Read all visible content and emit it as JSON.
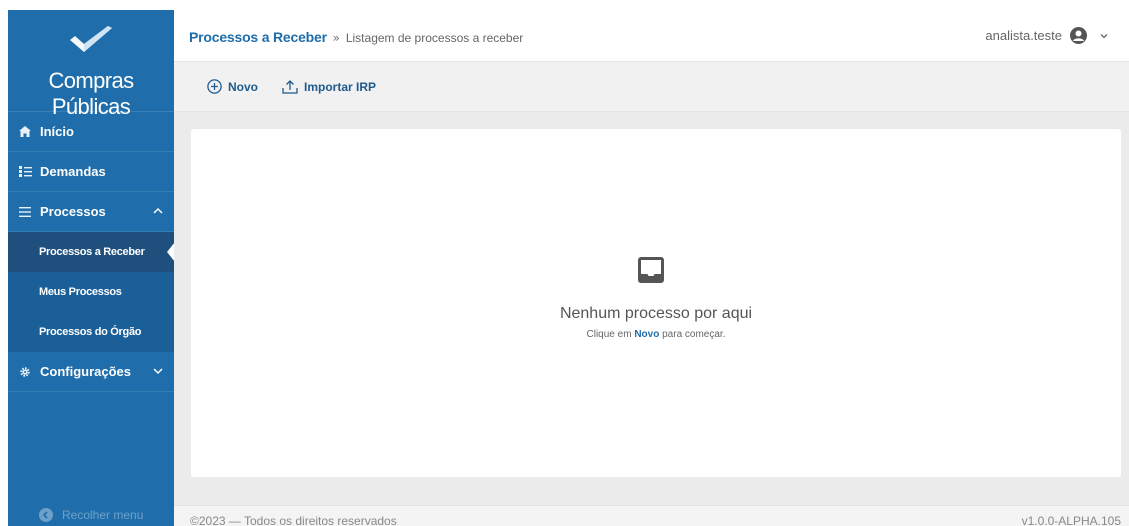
{
  "brand": {
    "name": "Compras Públicas",
    "logo_icon": "checkmark-logo-icon",
    "color": "#1f6eab"
  },
  "sidebar": {
    "items": [
      {
        "label": "Início",
        "icon": "home-icon"
      },
      {
        "label": "Demandas",
        "icon": "list-numbered-icon"
      },
      {
        "label": "Processos",
        "icon": "list-icon",
        "expanded": true,
        "children": [
          {
            "label": "Processos a Receber",
            "active": true
          },
          {
            "label": "Meus Processos"
          },
          {
            "label": "Processos do Órgão"
          }
        ]
      },
      {
        "label": "Configurações",
        "icon": "gear-icon",
        "expanded": false
      }
    ],
    "collapse_label": "Recolher menu"
  },
  "header": {
    "breadcrumb_main": "Processos a Receber",
    "breadcrumb_sep": "»",
    "breadcrumb_sub": "Listagem de processos a receber",
    "user_name": "analista.teste"
  },
  "toolbar": {
    "new_label": "Novo",
    "import_label": "Importar IRP"
  },
  "empty_state": {
    "title": "Nenhum processo por aqui",
    "sub_before": "Clique em",
    "sub_link": "Novo",
    "sub_after": "para começar."
  },
  "footer": {
    "copyright": "©2023 — Todos os direitos reservados",
    "version": "v1.0.0-ALPHA.105"
  }
}
